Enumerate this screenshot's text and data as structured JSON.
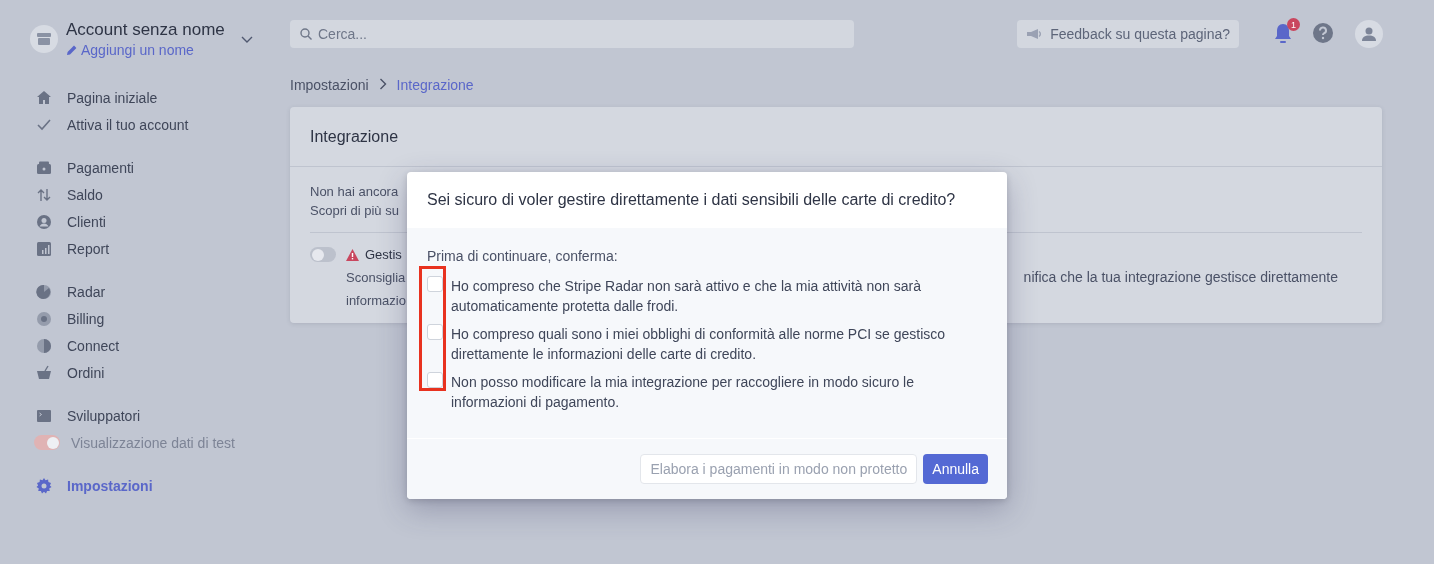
{
  "account": {
    "name": "Account senza nome",
    "add_name": "Aggiungi un nome"
  },
  "sidebar": {
    "groups": [
      [
        {
          "kind": "link",
          "label": "Pagina iniziale",
          "selected": false
        },
        {
          "kind": "link",
          "label": "Attiva il tuo account",
          "selected": false
        }
      ],
      [
        {
          "kind": "link",
          "label": "Pagamenti",
          "selected": false
        },
        {
          "kind": "link",
          "label": "Saldo",
          "selected": false
        },
        {
          "kind": "link",
          "label": "Clienti",
          "selected": false
        },
        {
          "kind": "link",
          "label": "Report",
          "selected": false
        }
      ],
      [
        {
          "kind": "link",
          "label": "Radar",
          "selected": false
        },
        {
          "kind": "link",
          "label": "Billing",
          "selected": false
        },
        {
          "kind": "link",
          "label": "Connect",
          "selected": false
        },
        {
          "kind": "link",
          "label": "Ordini",
          "selected": false
        }
      ],
      [
        {
          "kind": "link",
          "label": "Sviluppatori",
          "selected": false
        },
        {
          "kind": "toggle",
          "label": "Visualizzazione dati di test",
          "on": true,
          "disabled": true
        }
      ],
      [
        {
          "kind": "link",
          "label": "Impostazioni",
          "selected": true
        }
      ]
    ]
  },
  "topbar": {
    "search": {
      "placeholder": "Cerca..."
    },
    "feedback": "Feedback su questa pagina?",
    "notification_count": "1"
  },
  "breadcrumb": [
    {
      "label": "Impostazioni",
      "current": false
    },
    {
      "label": "Integrazione",
      "current": true
    }
  ],
  "card": {
    "title": "Integrazione",
    "intro": [
      "Non hai ancora",
      "Scopri di più su"
    ],
    "option": {
      "on": false,
      "title": "Gestis",
      "description": [
        "Sconsiglia",
        "informazio"
      ],
      "description_right": "nifica che la tua integrazione gestisce direttamente"
    }
  },
  "modal": {
    "title": "Sei sicuro di voler gestire direttamente i dati sensibili delle carte di credito?",
    "prompt": "Prima di continuare, conferma:",
    "highlight_checkboxes": true,
    "checks": [
      {
        "label": "Ho compreso che Stripe Radar non sarà attivo e che la mia attività non sarà automaticamente protetta dalle frodi.",
        "checked": false
      },
      {
        "label": "Ho compreso quali sono i miei obblighi di conformità alle norme PCI se gestisco direttamente le informazioni delle carte di credito.",
        "checked": false
      },
      {
        "label": "Non posso modificare la mia integrazione per raccogliere in modo sicuro le informazioni di pagamento.",
        "checked": false
      }
    ],
    "buttons": [
      {
        "kind": "secondary",
        "label": "Elabora i pagamenti in modo non protetto",
        "disabled": true
      },
      {
        "kind": "primary",
        "label": "Annulla",
        "disabled": false
      }
    ]
  }
}
